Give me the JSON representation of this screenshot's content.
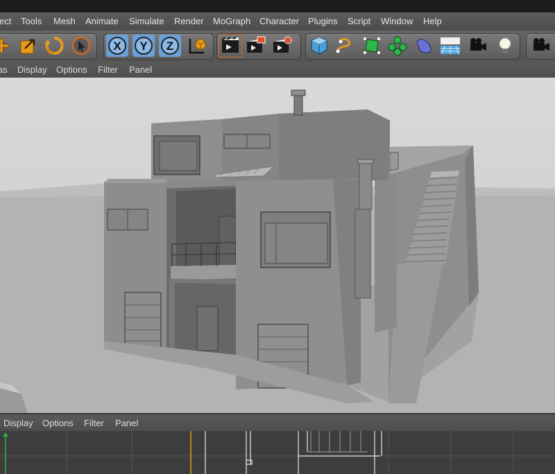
{
  "menubar": {
    "items": [
      "ect",
      "Tools",
      "Mesh",
      "Animate",
      "Simulate",
      "Render",
      "MoGraph",
      "Character",
      "Plugins",
      "Script",
      "Window",
      "Help"
    ]
  },
  "toolbar": {
    "axis_labels": [
      "X",
      "Y",
      "Z"
    ],
    "icons": [
      "move-icon",
      "scale-icon",
      "rotate-icon",
      "select-arrow-icon",
      "axis-x-icon",
      "axis-y-icon",
      "axis-z-icon",
      "coordinate-system-icon",
      "render-view-icon",
      "render-region-icon",
      "render-settings-icon",
      "cube-icon",
      "spline-icon",
      "nurbs-icon",
      "mograph-cloner-icon",
      "deformer-icon",
      "floor-icon",
      "camera-icon",
      "light-icon",
      "camera-icon-2"
    ],
    "colors": {
      "accent_orange": "#e79b1c",
      "accent_blue": "#4aa2dd",
      "accent_green": "#2fb54a"
    }
  },
  "viewport_menu": {
    "items": [
      "as",
      "Display",
      "Options",
      "Filter",
      "Panel"
    ]
  },
  "lower_panel": {
    "items": [
      "Display",
      "Options",
      "Filter",
      "Panel"
    ]
  }
}
